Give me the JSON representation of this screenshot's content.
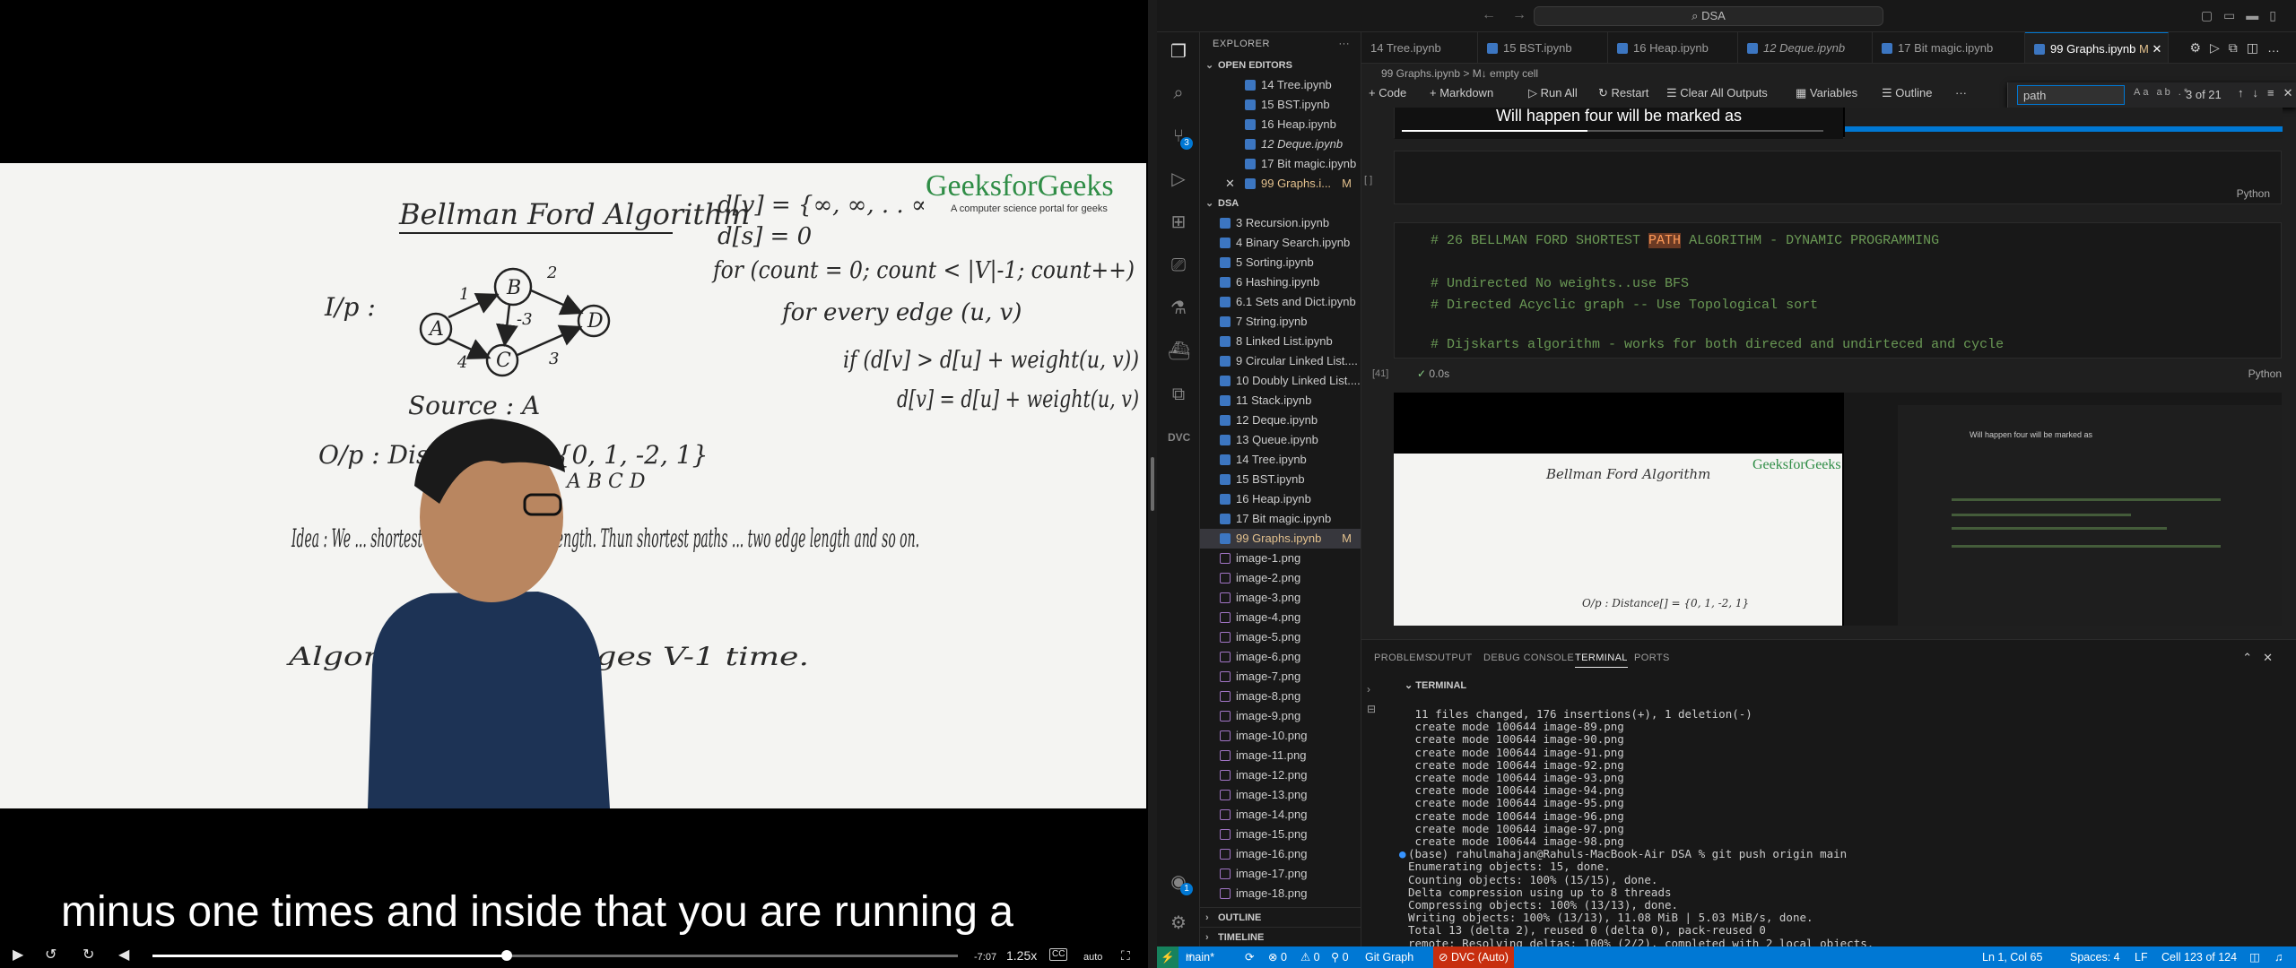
{
  "player": {
    "caption": "minus one times and inside that you are running a",
    "time_remaining": "-7:07",
    "speed": "1.25x",
    "cc_label": "CC",
    "quality": "auto",
    "progress": 0.44,
    "whiteboard": {
      "brand": "GeeksforGeeks",
      "brand_tagline": "A computer science portal for geeks",
      "title": "Bellman Ford Algorithm",
      "input_label": "I/p :",
      "source_label": "Source : A",
      "output_label": "O/p : Distance[] = {0, 1, -2, 1}",
      "output_letters": "A   B   C   D",
      "idea": "Idea : We ... shortest paths that are of ... length. Thun shortest paths ... two edge length and so on.",
      "algorithm": "Algorithm ... all edges V-1 time.",
      "code_lines": [
        "d[v] = {∞, ∞, . . ∞}",
        "d[s] = 0",
        "for (count = 0; count < |V|-1; count++)",
        "for every edge (u, v)",
        "if (d[v] > d[u] + weight(u, v))",
        "d[v] = d[u] + weight(u, v)"
      ],
      "graph": {
        "nodes": [
          "A",
          "B",
          "C",
          "D"
        ],
        "edges": [
          {
            "from": "A",
            "to": "B",
            "w": "1"
          },
          {
            "from": "A",
            "to": "C",
            "w": "4"
          },
          {
            "from": "B",
            "to": "C",
            "w": "-3"
          },
          {
            "from": "B",
            "to": "D",
            "w": "2"
          },
          {
            "from": "C",
            "to": "D",
            "w": "3"
          }
        ]
      }
    }
  },
  "vscode": {
    "search": "DSA",
    "explorer_title": "EXPLORER",
    "open_editors_title": "OPEN EDITORS",
    "open_editors": [
      {
        "name": "14 Tree.ipynb",
        "italic": false
      },
      {
        "name": "15 BST.ipynb",
        "italic": false
      },
      {
        "name": "16 Heap.ipynb",
        "italic": false
      },
      {
        "name": "12 Deque.ipynb",
        "italic": true
      },
      {
        "name": "17 Bit magic.ipynb",
        "italic": false
      },
      {
        "name": "99 Graphs.i...",
        "italic": false,
        "active": true,
        "mod": "M"
      }
    ],
    "folder_title": "DSA",
    "files": [
      {
        "name": "3 Recursion.ipynb",
        "t": "nb"
      },
      {
        "name": "4 Binary Search.ipynb",
        "t": "nb"
      },
      {
        "name": "5 Sorting.ipynb",
        "t": "nb"
      },
      {
        "name": "6 Hashing.ipynb",
        "t": "nb"
      },
      {
        "name": "6.1 Sets and Dict.ipynb",
        "t": "nb"
      },
      {
        "name": "7 String.ipynb",
        "t": "nb"
      },
      {
        "name": "8 Linked List.ipynb",
        "t": "nb"
      },
      {
        "name": "9 Circular Linked List....",
        "t": "nb"
      },
      {
        "name": "10 Doubly Linked List....",
        "t": "nb"
      },
      {
        "name": "11 Stack.ipynb",
        "t": "nb"
      },
      {
        "name": "12 Deque.ipynb",
        "t": "nb"
      },
      {
        "name": "13 Queue.ipynb",
        "t": "nb"
      },
      {
        "name": "14 Tree.ipynb",
        "t": "nb"
      },
      {
        "name": "15 BST.ipynb",
        "t": "nb"
      },
      {
        "name": "16 Heap.ipynb",
        "t": "nb"
      },
      {
        "name": "17 Bit magic.ipynb",
        "t": "nb"
      },
      {
        "name": "99 Graphs.ipynb",
        "t": "nb",
        "mod": "M",
        "sel": true
      },
      {
        "name": "image-1.png",
        "t": "img"
      },
      {
        "name": "image-2.png",
        "t": "img"
      },
      {
        "name": "image-3.png",
        "t": "img"
      },
      {
        "name": "image-4.png",
        "t": "img"
      },
      {
        "name": "image-5.png",
        "t": "img"
      },
      {
        "name": "image-6.png",
        "t": "img"
      },
      {
        "name": "image-7.png",
        "t": "img"
      },
      {
        "name": "image-8.png",
        "t": "img"
      },
      {
        "name": "image-9.png",
        "t": "img"
      },
      {
        "name": "image-10.png",
        "t": "img"
      },
      {
        "name": "image-11.png",
        "t": "img"
      },
      {
        "name": "image-12.png",
        "t": "img"
      },
      {
        "name": "image-13.png",
        "t": "img"
      },
      {
        "name": "image-14.png",
        "t": "img"
      },
      {
        "name": "image-15.png",
        "t": "img"
      },
      {
        "name": "image-16.png",
        "t": "img"
      },
      {
        "name": "image-17.png",
        "t": "img"
      },
      {
        "name": "image-18.png",
        "t": "img"
      }
    ],
    "outline_title": "OUTLINE",
    "timeline_title": "TIMELINE",
    "tabs": [
      {
        "name": "14 Tree.ipynb"
      },
      {
        "name": "15 BST.ipynb"
      },
      {
        "name": "16 Heap.ipynb"
      },
      {
        "name": "12 Deque.ipynb",
        "italic": true
      },
      {
        "name": "17 Bit magic.ipynb"
      },
      {
        "name": "99 Graphs.ipynb",
        "mod": "M",
        "on": true
      }
    ],
    "breadcrumb": "99 Graphs.ipynb > M↓ empty cell",
    "toolbar": {
      "code": "+ Code",
      "markdown": "+ Markdown",
      "run_all": "▷ Run All",
      "restart": "↻ Restart",
      "clear": "☰ Clear All Outputs",
      "variables": "▦ Variables",
      "outline": "☰ Outline",
      "more": "···"
    },
    "find": {
      "query": "path",
      "count": "3 of 21",
      "opts": "Aa ab .*"
    },
    "video_in_cell_caption": "Will happen four will be marked as",
    "cells": {
      "empty_exec": "[ ]",
      "empty_lang": "Python",
      "md_lines": [
        "# 26 BELLMAN FORD SHORTEST ",
        "PATH",
        " ALGORITHM - DYNAMIC PROGRAMMING",
        "# Undirected No weights..use BFS",
        "# Directed Acyclic graph -- Use Topological sort",
        "# Dijskarts algorithm - works for both direced and undirteced and cycle"
      ],
      "md_exec": "[41]",
      "md_time": "0.0s",
      "md_lang": "Python"
    },
    "panel": {
      "tabs": [
        "PROBLEMS",
        "OUTPUT",
        "DEBUG CONSOLE",
        "TERMINAL",
        "PORTS"
      ],
      "active": "TERMINAL",
      "terminal_title": "TERMINAL",
      "lines": [
        " 11 files changed, 176 insertions(+), 1 deletion(-)",
        " create mode 100644 image-89.png",
        " create mode 100644 image-90.png",
        " create mode 100644 image-91.png",
        " create mode 100644 image-92.png",
        " create mode 100644 image-93.png",
        " create mode 100644 image-94.png",
        " create mode 100644 image-95.png",
        " create mode 100644 image-96.png",
        " create mode 100644 image-97.png",
        " create mode 100644 image-98.png",
        "(base) rahulmahajan@Rahuls-MacBook-Air DSA % git push origin main",
        "Enumerating objects: 15, done.",
        "Counting objects: 100% (15/15), done.",
        "Delta compression using up to 8 threads",
        "Compressing objects: 100% (13/13), done.",
        "Writing objects: 100% (13/13), 11.08 MiB | 5.03 MiB/s, done.",
        "Total 13 (delta 2), reused 0 (delta 0), pack-reused 0",
        "remote: Resolving deltas: 100% (2/2), completed with 2 local objects."
      ]
    },
    "statusbar": {
      "branch": "main*",
      "sync": "⟳",
      "errors": "⊗ 0",
      "warnings": "⚠ 0",
      "ports": "⚲ 0",
      "gitgraph": "Git Graph",
      "dvc": "⊘ DVC (Auto)",
      "position": "Ln 1, Col 65",
      "spaces": "Spaces: 4",
      "eol": "LF",
      "cell": "Cell 123 of 124"
    },
    "badges": {
      "scm": "3",
      "accounts": "1"
    }
  }
}
